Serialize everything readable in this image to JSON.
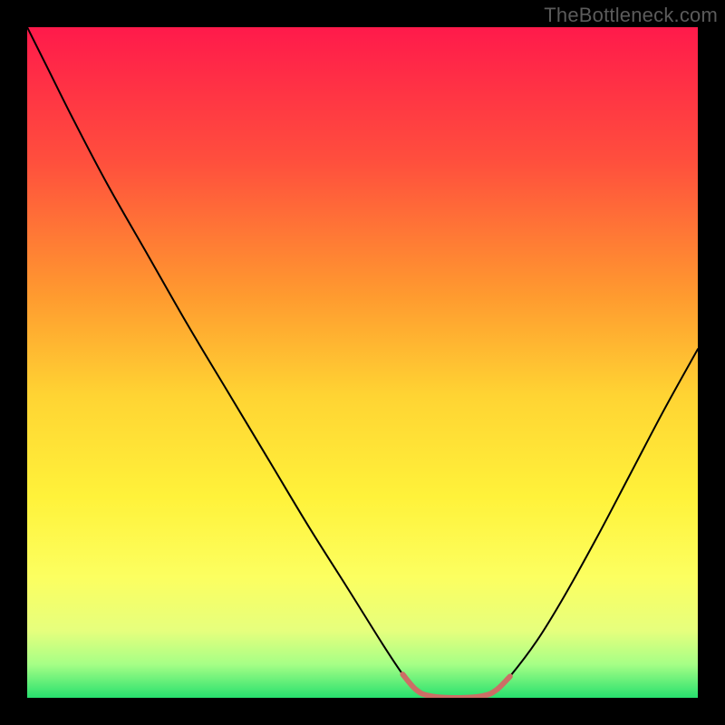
{
  "watermark": "TheBottleneck.com",
  "chart_data": {
    "type": "line",
    "title": "",
    "xlabel": "",
    "ylabel": "",
    "xlim": [
      0,
      100
    ],
    "ylim": [
      0,
      100
    ],
    "background_gradient": {
      "stops": [
        {
          "offset": 0.0,
          "color": "#ff1a4b"
        },
        {
          "offset": 0.2,
          "color": "#ff4f3d"
        },
        {
          "offset": 0.4,
          "color": "#ff9a2f"
        },
        {
          "offset": 0.55,
          "color": "#ffd433"
        },
        {
          "offset": 0.7,
          "color": "#fff23a"
        },
        {
          "offset": 0.82,
          "color": "#fcff60"
        },
        {
          "offset": 0.9,
          "color": "#e6ff7d"
        },
        {
          "offset": 0.95,
          "color": "#a6ff86"
        },
        {
          "offset": 1.0,
          "color": "#27e06e"
        }
      ]
    },
    "series": [
      {
        "name": "bottleneck-curve",
        "type": "line",
        "color": "#000000",
        "width": 2,
        "points": [
          {
            "x": 0,
            "y": 100.0
          },
          {
            "x": 3,
            "y": 94.0
          },
          {
            "x": 7,
            "y": 86.0
          },
          {
            "x": 12,
            "y": 76.5
          },
          {
            "x": 18,
            "y": 66.0
          },
          {
            "x": 24,
            "y": 55.5
          },
          {
            "x": 30,
            "y": 45.5
          },
          {
            "x": 36,
            "y": 35.5
          },
          {
            "x": 42,
            "y": 25.5
          },
          {
            "x": 48,
            "y": 16.0
          },
          {
            "x": 53,
            "y": 8.0
          },
          {
            "x": 56,
            "y": 3.5
          },
          {
            "x": 58,
            "y": 1.2
          },
          {
            "x": 60,
            "y": 0.3
          },
          {
            "x": 64,
            "y": 0.0
          },
          {
            "x": 68,
            "y": 0.3
          },
          {
            "x": 70,
            "y": 1.2
          },
          {
            "x": 72,
            "y": 3.2
          },
          {
            "x": 76,
            "y": 8.5
          },
          {
            "x": 80,
            "y": 15.0
          },
          {
            "x": 85,
            "y": 24.0
          },
          {
            "x": 90,
            "y": 33.5
          },
          {
            "x": 95,
            "y": 43.0
          },
          {
            "x": 100,
            "y": 52.0
          }
        ]
      },
      {
        "name": "highlight-region",
        "type": "line",
        "color": "#cc6e66",
        "width": 6,
        "points": [
          {
            "x": 56,
            "y": 3.5
          },
          {
            "x": 58,
            "y": 1.2
          },
          {
            "x": 60,
            "y": 0.3
          },
          {
            "x": 64,
            "y": 0.0
          },
          {
            "x": 68,
            "y": 0.3
          },
          {
            "x": 70,
            "y": 1.2
          },
          {
            "x": 72,
            "y": 3.2
          }
        ]
      }
    ]
  }
}
